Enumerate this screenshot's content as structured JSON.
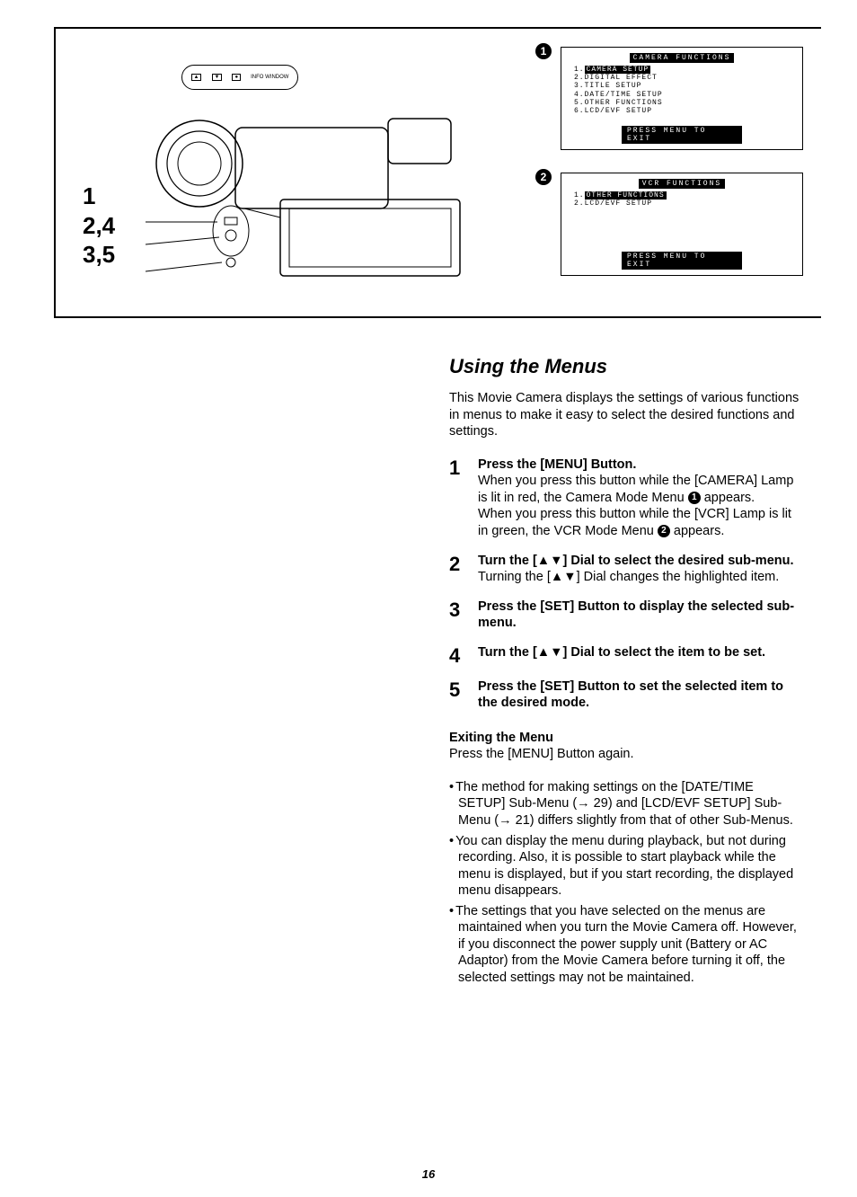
{
  "diagram": {
    "info_window_label": "INFO WINDOW",
    "step_labels": [
      "1",
      "2,4",
      "3,5"
    ],
    "callout_badges": [
      "1",
      "2"
    ],
    "screen1": {
      "title": "CAMERA FUNCTIONS",
      "items": [
        {
          "n": "1.",
          "label": "CAMERA SETUP",
          "hl": true
        },
        {
          "n": "2.",
          "label": "DIGITAL EFFECT",
          "hl": false
        },
        {
          "n": "3.",
          "label": "TITLE SETUP",
          "hl": false
        },
        {
          "n": "4.",
          "label": "DATE/TIME SETUP",
          "hl": false
        },
        {
          "n": "5.",
          "label": "OTHER FUNCTIONS",
          "hl": false
        },
        {
          "n": "6.",
          "label": "LCD/EVF SETUP",
          "hl": false
        }
      ],
      "footer": "PRESS MENU TO EXIT"
    },
    "screen2": {
      "title": "VCR FUNCTIONS",
      "items": [
        {
          "n": "1.",
          "label": "OTHER FUNCTIONS",
          "hl": true
        },
        {
          "n": "2.",
          "label": "LCD/EVF SETUP",
          "hl": false
        }
      ],
      "footer": "PRESS MENU TO EXIT"
    }
  },
  "content": {
    "title": "Using the Menus",
    "intro": "This Movie Camera displays the settings of various functions in menus to make it easy to select the desired functions and settings.",
    "steps": [
      {
        "num": "1",
        "head": "Press the [MENU] Button.",
        "body_a": "When you press this button while the [CAMERA] Lamp is lit in red, the Camera Mode Menu ",
        "badge_a": "1",
        "body_b": " appears.\nWhen you press this button while the [VCR] Lamp is lit in green, the VCR Mode Menu ",
        "badge_b": "2",
        "body_c": " appears."
      },
      {
        "num": "2",
        "head": "Turn the [▲▼] Dial to select the desired sub-menu.",
        "body": "Turning the [▲▼] Dial changes the highlighted item."
      },
      {
        "num": "3",
        "head": "Press the [SET] Button to display the selected sub-menu."
      },
      {
        "num": "4",
        "head": "Turn the [▲▼] Dial to select the item to be set."
      },
      {
        "num": "5",
        "head": "Press the [SET] Button to set the selected item to the desired mode."
      }
    ],
    "exit_head": "Exiting the Menu",
    "exit_body": "Press the [MENU] Button again.",
    "notes": [
      "The method for making settings on the [DATE/TIME SETUP] Sub-Menu (→ 29) and [LCD/EVF SETUP] Sub-Menu (→ 21) differs slightly from that of other Sub-Menus.",
      "You can display the menu during playback, but not during recording. Also, it is possible to start playback while the menu is displayed, but if you start recording, the displayed menu disappears.",
      "The settings that you have selected on the menus are maintained when you turn the Movie Camera off. However, if you disconnect the power supply unit (Battery or AC Adaptor) from the Movie Camera before turning it off, the selected settings may not be maintained."
    ]
  },
  "page_number": "16"
}
